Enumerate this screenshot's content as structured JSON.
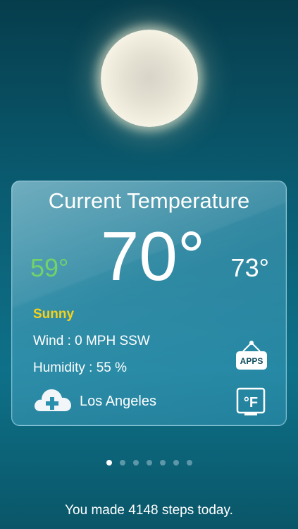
{
  "card": {
    "title": "Current Temperature",
    "temperature": "70°",
    "low": "59°",
    "high": "73°",
    "condition": "Sunny",
    "wind": "Wind : 0 MPH SSW",
    "humidity": "Humidity : 55 %",
    "city": "Los Angeles",
    "apps_label": "APPS",
    "unit_label": "°F"
  },
  "pager": {
    "count": 7,
    "active_index": 0
  },
  "footer": {
    "steps_text": "You made 4148 steps today."
  },
  "colors": {
    "low_temp": "#72d26a",
    "condition": "#f4d21c",
    "background_top": "#063d4c",
    "background_bottom": "#0a5668"
  },
  "icons": [
    "sun-icon",
    "cloud-add-icon",
    "apps-sign-icon",
    "fahrenheit-toggle-icon"
  ]
}
